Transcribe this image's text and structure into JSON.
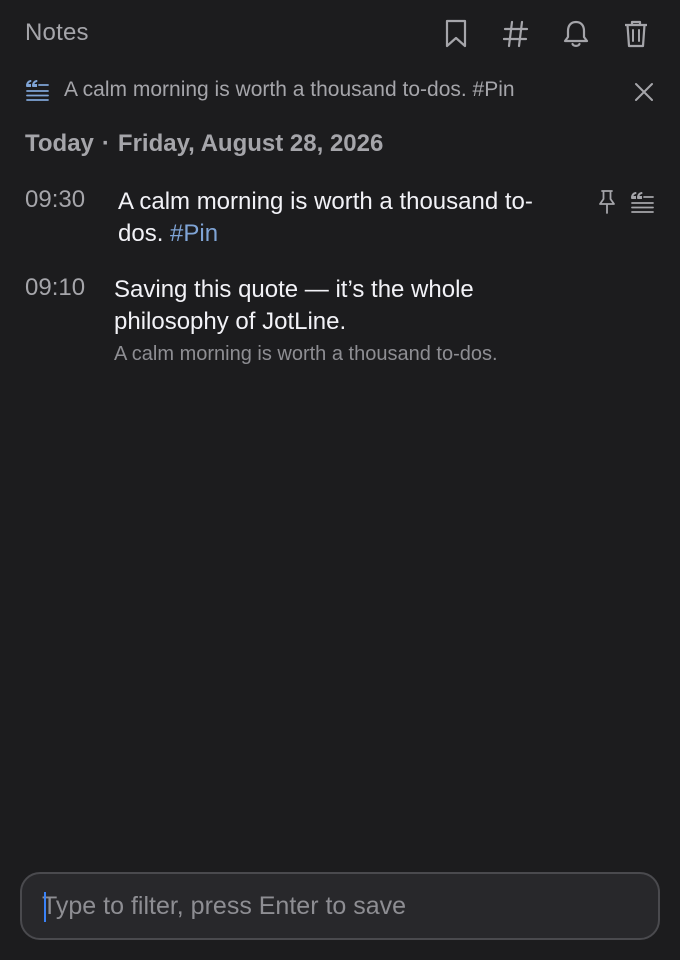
{
  "header": {
    "title": "Notes",
    "icons": [
      "bookmark-icon",
      "hashtag-icon",
      "bell-icon",
      "trash-icon"
    ]
  },
  "pinned": {
    "icon": "quote-icon",
    "text": "A calm morning is worth a thousand to-dos. #Pin"
  },
  "date_heading": {
    "day": "Today",
    "separator": "·",
    "date": "Friday, August 28, 2026"
  },
  "notes": [
    {
      "time": "09:30",
      "text": "A calm morning is worth a thousand to-dos.",
      "tag": "#Pin",
      "actions": [
        "pin-icon",
        "quote-icon"
      ]
    },
    {
      "time": "09:10",
      "text": "Saving this quote — it’s the whole philosophy of JotLine.",
      "quote": "A calm morning is worth a thousand to-dos."
    }
  ],
  "input": {
    "placeholder": "Type to filter, press Enter to save",
    "value": ""
  },
  "colors": {
    "background": "#1c1c1e",
    "muted_text": "#a5a5aa",
    "tag": "#7fa4d6",
    "caret": "#3a82f7"
  }
}
